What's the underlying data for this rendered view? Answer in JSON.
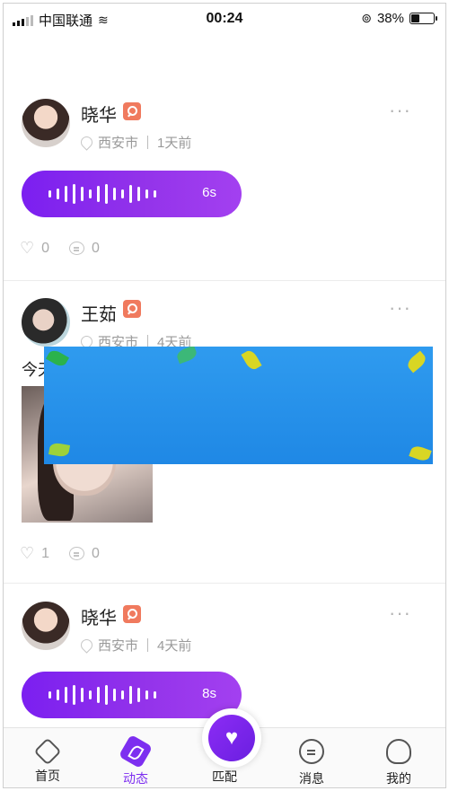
{
  "status_bar": {
    "carrier": "中国联通",
    "time": "00:24",
    "battery": "38%",
    "battery_level": 0.38
  },
  "posts": [
    {
      "name": "晓华",
      "location": "西安市",
      "time": "1天前",
      "voice_duration": "6s",
      "likes": "0",
      "comments": "0"
    },
    {
      "name": "王茹",
      "location": "西安市",
      "time": "4天前",
      "text": "今天",
      "likes": "1",
      "comments": "0"
    },
    {
      "name": "晓华",
      "location": "西安市",
      "time": "4天前",
      "voice_duration": "8s"
    }
  ],
  "more_label": "···",
  "tabs": [
    {
      "label": "首页",
      "icon": "home-icon"
    },
    {
      "label": "动态",
      "icon": "moments-icon"
    },
    {
      "label": "匹配",
      "icon": "match-heart-icon"
    },
    {
      "label": "消息",
      "icon": "message-icon"
    },
    {
      "label": "我的",
      "icon": "profile-icon"
    }
  ],
  "colors": {
    "accent": "#7d2ff0",
    "badge": "#f07a5e",
    "banner": "#1f88e5"
  }
}
